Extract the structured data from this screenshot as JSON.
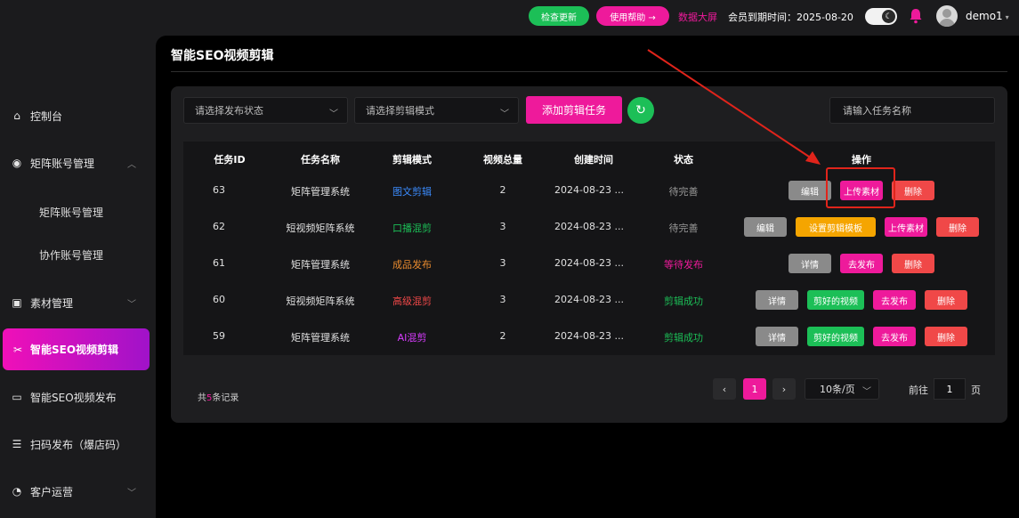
{
  "topbar": {
    "check_update": "检查更新",
    "help": "使用帮助 →",
    "data_screen": "数据大屏",
    "expire_label": "会员到期时间：2025-08-20",
    "username": "demo1",
    "icons": {
      "theme": "moon-icon",
      "bell": "bell-icon",
      "caret": "caret-down-icon"
    },
    "colors": {
      "green": "#1cbf57",
      "pink": "#ee1a9b",
      "red": "#ee1a9b"
    }
  },
  "sidebar": {
    "items": [
      {
        "label": "控制台",
        "icon": "home-icon"
      },
      {
        "label": "矩阵账号管理",
        "icon": "account-icon",
        "expanded": true
      },
      {
        "label": "矩阵账号管理",
        "sub": true
      },
      {
        "label": "协作账号管理",
        "sub": true
      },
      {
        "label": "素材管理",
        "icon": "material-icon"
      },
      {
        "label": "智能SEO视频剪辑",
        "icon": "scissors-icon",
        "active": true
      },
      {
        "label": "智能SEO视频发布",
        "icon": "video-icon"
      },
      {
        "label": "扫码发布（爆店码）",
        "icon": "scan-icon"
      },
      {
        "label": "客户运营",
        "icon": "customer-icon"
      }
    ]
  },
  "main": {
    "title": "智能SEO视频剪辑",
    "filters": {
      "status_placeholder": "请选择发布状态",
      "mode_placeholder": "请选择剪辑模式",
      "add_button": "添加剪辑任务",
      "search_placeholder": "请输入任务名称"
    },
    "table": {
      "headers": [
        "任务ID",
        "任务名称",
        "剪辑模式",
        "视频总量",
        "创建时间",
        "状态",
        "操作"
      ],
      "rows": [
        {
          "id": "63",
          "name": "矩阵管理系统",
          "mode": "图文剪辑",
          "mode_color": "#3b8cff",
          "total": "2",
          "created": "2024-08-23 ...",
          "status": "待完善",
          "status_color": "#9a9a9a",
          "actions": [
            {
              "label": "编辑",
              "color": "#8a8a8a"
            },
            {
              "label": "上传素材",
              "color": "#ee1a9b"
            },
            {
              "label": "删除",
              "color": "#f04848"
            }
          ]
        },
        {
          "id": "62",
          "name": "短视频矩阵系统",
          "mode": "口播混剪",
          "mode_color": "#1cbf57",
          "total": "3",
          "created": "2024-08-23 ...",
          "status": "待完善",
          "status_color": "#9a9a9a",
          "actions": [
            {
              "label": "编辑",
              "color": "#8a8a8a"
            },
            {
              "label": "设置剪辑模板",
              "color": "#f5a500"
            },
            {
              "label": "上传素材",
              "color": "#ee1a9b"
            },
            {
              "label": "删除",
              "color": "#f04848"
            }
          ]
        },
        {
          "id": "61",
          "name": "矩阵管理系统",
          "mode": "成品发布",
          "mode_color": "#e88a2e",
          "total": "3",
          "created": "2024-08-23 ...",
          "status": "等待发布",
          "status_color": "#ee1a9b",
          "actions": [
            {
              "label": "详情",
              "color": "#8a8a8a"
            },
            {
              "label": "去发布",
              "color": "#ee1a9b"
            },
            {
              "label": "删除",
              "color": "#f04848"
            }
          ]
        },
        {
          "id": "60",
          "name": "短视频矩阵系统",
          "mode": "高级混剪",
          "mode_color": "#f04848",
          "total": "3",
          "created": "2024-08-23 ...",
          "status": "剪辑成功",
          "status_color": "#1cbf57",
          "actions": [
            {
              "label": "详情",
              "color": "#8a8a8a"
            },
            {
              "label": "剪好的视频",
              "color": "#1cbf57"
            },
            {
              "label": "去发布",
              "color": "#ee1a9b"
            },
            {
              "label": "删除",
              "color": "#f04848"
            }
          ]
        },
        {
          "id": "59",
          "name": "矩阵管理系统",
          "mode": "AI混剪",
          "mode_color": "#d83cff",
          "total": "2",
          "created": "2024-08-23 ...",
          "status": "剪辑成功",
          "status_color": "#1cbf57",
          "actions": [
            {
              "label": "详情",
              "color": "#8a8a8a"
            },
            {
              "label": "剪好的视频",
              "color": "#1cbf57"
            },
            {
              "label": "去发布",
              "color": "#ee1a9b"
            },
            {
              "label": "删除",
              "color": "#f04848"
            }
          ]
        }
      ]
    },
    "pagination": {
      "total_prefix": "共",
      "total_count": "5",
      "total_suffix": "条记录",
      "current_page": "1",
      "page_size": "10条/页",
      "goto_label": "前往",
      "goto_value": "1",
      "page_unit": "页"
    }
  }
}
